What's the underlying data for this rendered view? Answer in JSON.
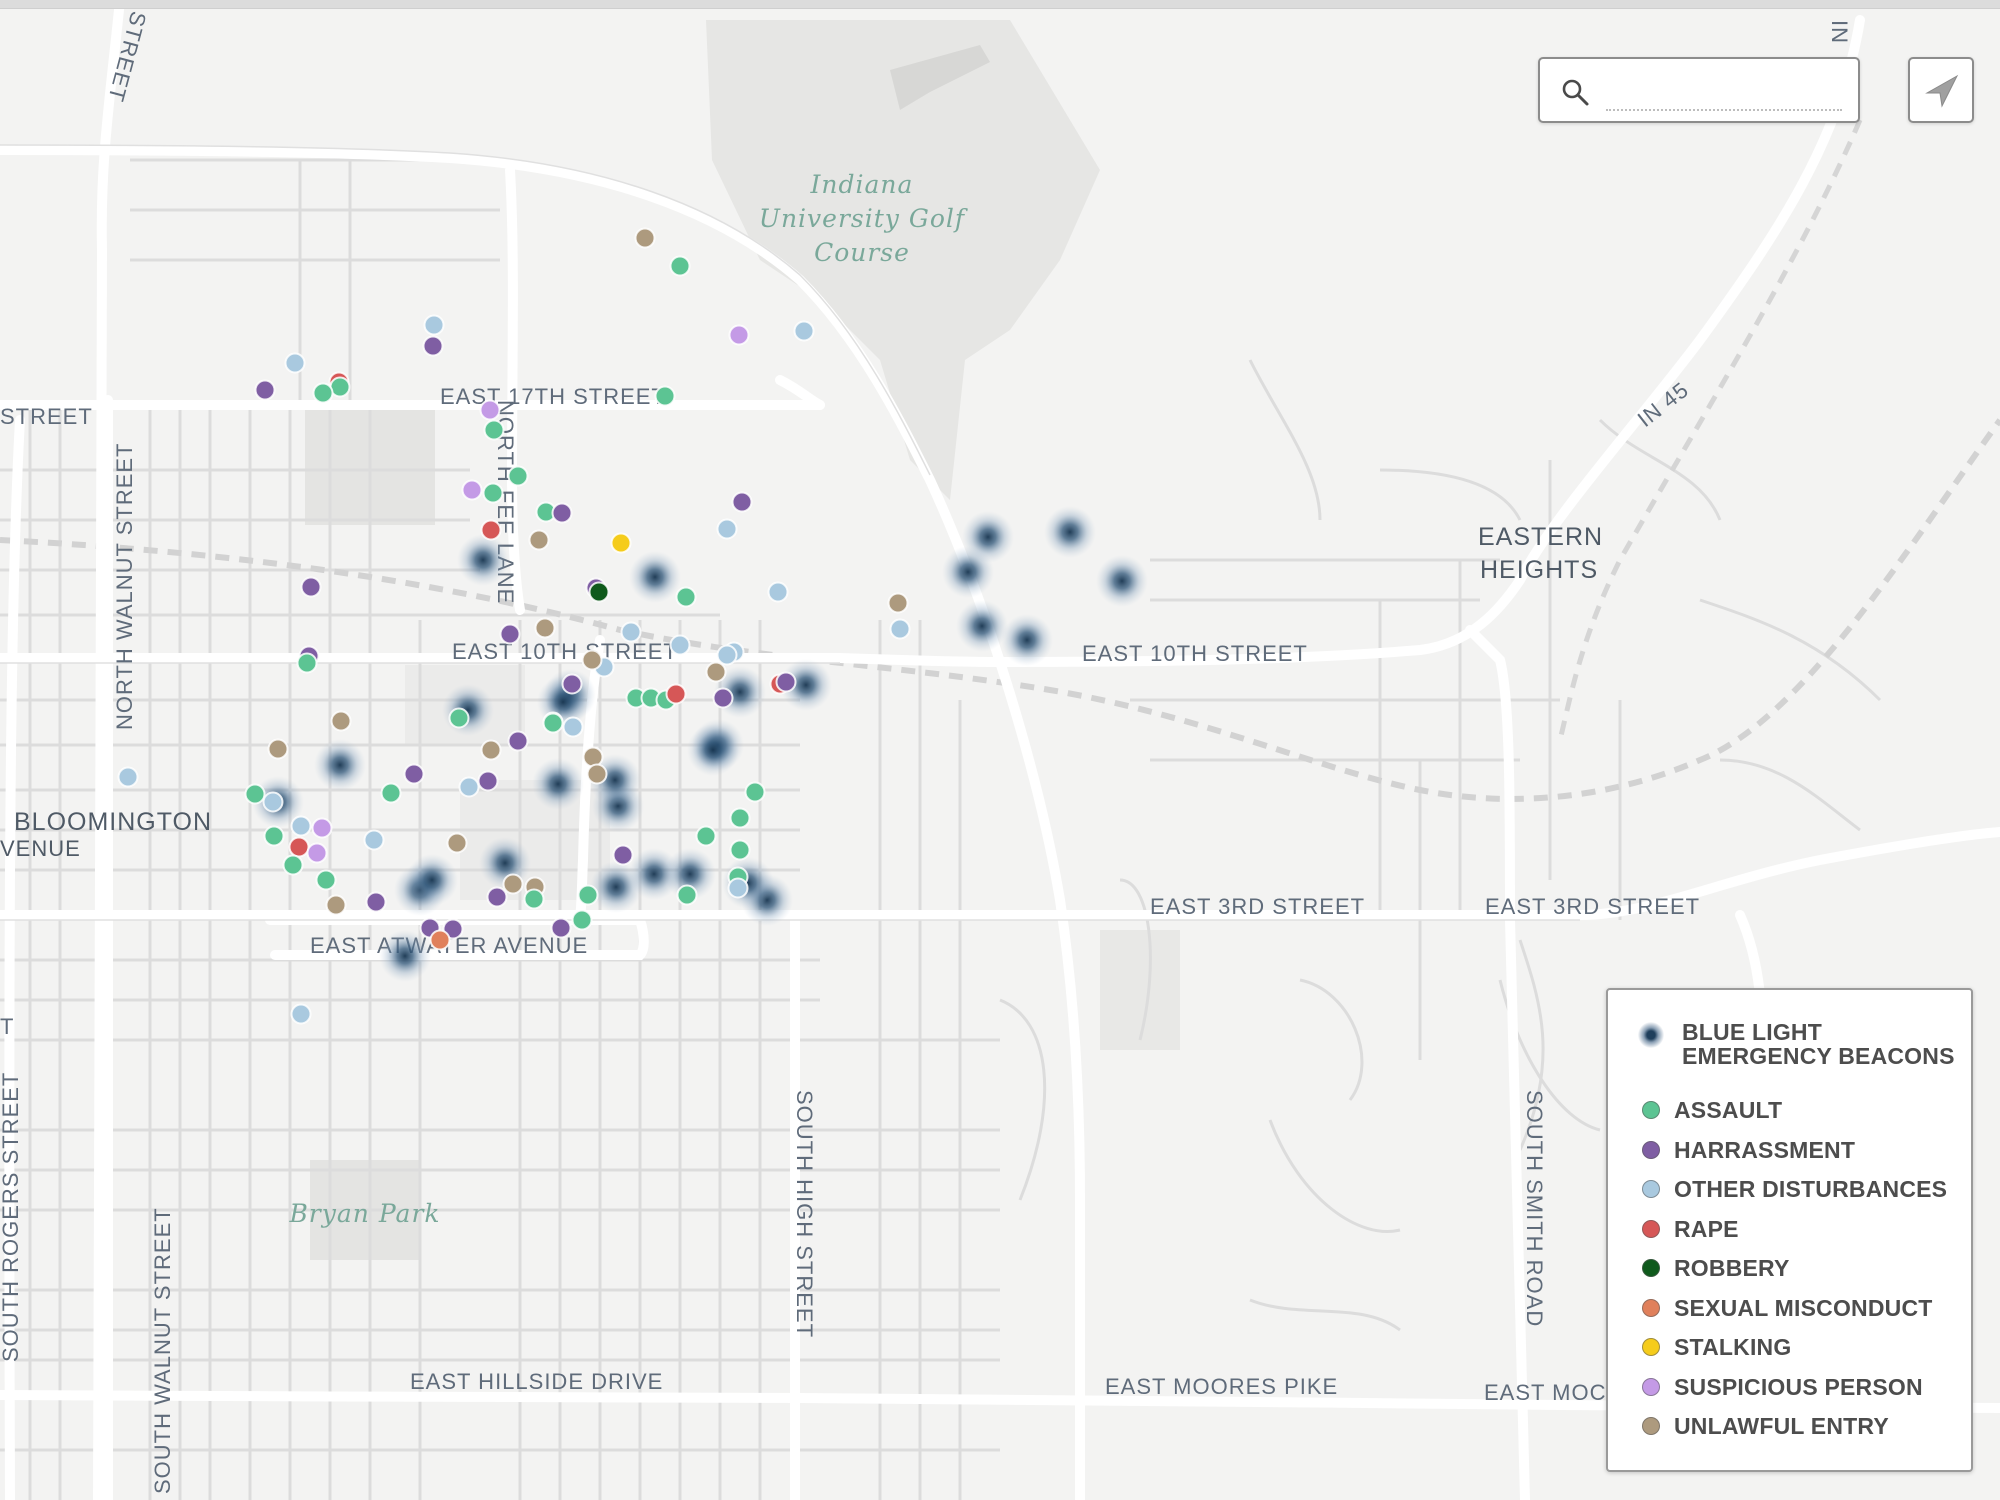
{
  "search": {
    "placeholder": "",
    "value": "",
    "icon": "search-icon"
  },
  "locate_button": {
    "icon": "location-arrow-icon"
  },
  "map": {
    "labels": {
      "golf_course": [
        "Indiana",
        "University Golf",
        "Course"
      ],
      "east_17th": "EAST 17TH STREET",
      "street_left": "STREET",
      "north_fee_lane": "NORTH FEE LANE",
      "north_walnut": "NORTH WALNUT STREET",
      "east_10th_a": "EAST 10TH STREET",
      "east_10th_b": "EAST 10TH STREET",
      "eastern_heights": [
        "EASTERN",
        "HEIGHTS"
      ],
      "in45": "IN 45",
      "in_top": "IN",
      "bloomington": "BLOOMINGTON",
      "venue": "VENUE",
      "east_3rd_a": "EAST 3RD STREET",
      "east_3rd_b": "EAST 3RD STREET",
      "atwater": "EAST ATWATER AVENUE",
      "south_rogers": "SOUTH ROGERS STREET",
      "south_walnut": "SOUTH WALNUT STREET",
      "south_high": "SOUTH HIGH STREET",
      "south_smith": "SOUTH SMITH ROAD",
      "bryan_park": "Bryan Park",
      "hillside": "EAST HILLSIDE DRIVE",
      "moores_pike": "EAST MOORES PIKE",
      "east_moc": "EAST MOC",
      "top_street": "STREET",
      "left_t": "T"
    }
  },
  "legend": {
    "beacons": [
      "BLUE LIGHT",
      "EMERGENCY BEACONS"
    ],
    "items": [
      {
        "label": "ASSAULT",
        "color": "#5cc493"
      },
      {
        "label": "HARRASSMENT",
        "color": "#7f5ea3"
      },
      {
        "label": "OTHER DISTURBANCES",
        "color": "#a9c9df"
      },
      {
        "label": "RAPE",
        "color": "#d65757"
      },
      {
        "label": "ROBBERY",
        "color": "#0f5a1c"
      },
      {
        "label": "SEXUAL MISCONDUCT",
        "color": "#e0805b"
      },
      {
        "label": "STALKING",
        "color": "#f5cc1b"
      },
      {
        "label": "SUSPICIOUS PERSON",
        "color": "#c49ae6"
      },
      {
        "label": "UNLAWFUL ENTRY",
        "color": "#ad9a7e"
      }
    ]
  }
}
